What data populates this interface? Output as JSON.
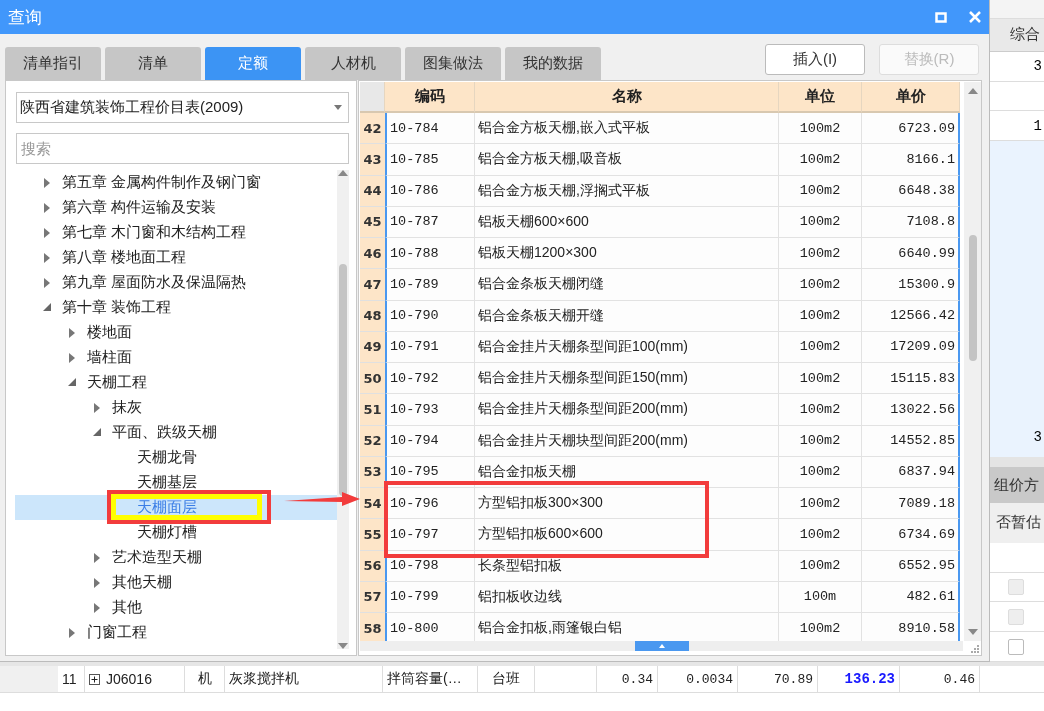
{
  "window": {
    "title": "查询"
  },
  "tabs": [
    {
      "label": "清单指引",
      "selected": false
    },
    {
      "label": "清单",
      "selected": false
    },
    {
      "label": "定额",
      "selected": true
    },
    {
      "label": "人材机",
      "selected": false
    },
    {
      "label": "图集做法",
      "selected": false
    },
    {
      "label": "我的数据",
      "selected": false
    }
  ],
  "buttons": [
    {
      "label": "插入(I)",
      "disabled": false
    },
    {
      "label": "替换(R)",
      "disabled": true
    }
  ],
  "library_select": {
    "value": "陕西省建筑装饰工程价目表(2009)"
  },
  "search": {
    "placeholder": "搜索"
  },
  "tree": [
    {
      "label": "第五章 金属构件制作及钢门窗",
      "expanded": false,
      "selected": false
    },
    {
      "label": "第六章 构件运输及安装",
      "expanded": false,
      "selected": false
    },
    {
      "label": "第七章 木门窗和木结构工程",
      "expanded": false,
      "selected": false
    },
    {
      "label": "第八章 楼地面工程",
      "expanded": false,
      "selected": false
    },
    {
      "label": "第九章 屋面防水及保温隔热",
      "expanded": false,
      "selected": false
    },
    {
      "label": "第十章 装饰工程",
      "expanded": true,
      "selected": false,
      "children": [
        {
          "label": "楼地面",
          "expanded": false,
          "selected": false
        },
        {
          "label": "墙柱面",
          "expanded": false,
          "selected": false
        },
        {
          "label": "天棚工程",
          "expanded": true,
          "selected": false,
          "children": [
            {
              "label": "抹灰",
              "expanded": false,
              "selected": false
            },
            {
              "label": "平面、跌级天棚",
              "expanded": true,
              "selected": false,
              "children": [
                {
                  "label": "天棚龙骨",
                  "selected": false
                },
                {
                  "label": "天棚基层",
                  "selected": false
                },
                {
                  "label": "天棚面层",
                  "selected": true
                },
                {
                  "label": "天棚灯槽",
                  "selected": false
                }
              ]
            },
            {
              "label": "艺术造型天棚",
              "expanded": false,
              "selected": false
            },
            {
              "label": "其他天棚",
              "expanded": false,
              "selected": false
            },
            {
              "label": "其他",
              "expanded": false,
              "selected": false
            }
          ]
        },
        {
          "label": "门窗工程",
          "expanded": false,
          "selected": false
        }
      ]
    }
  ],
  "table": {
    "columns": [
      "编码",
      "名称",
      "单位",
      "单价"
    ],
    "rows": [
      {
        "number": "42",
        "code": "10-784",
        "name": "铝合金方板天棚,嵌入式平板",
        "unit": "100m2",
        "price": "6723.09"
      },
      {
        "number": "43",
        "code": "10-785",
        "name": "铝合金方板天棚,吸音板",
        "unit": "100m2",
        "price": "8166.1"
      },
      {
        "number": "44",
        "code": "10-786",
        "name": "铝合金方板天棚,浮搁式平板",
        "unit": "100m2",
        "price": "6648.38"
      },
      {
        "number": "45",
        "code": "10-787",
        "name": "铝板天棚600×600",
        "unit": "100m2",
        "price": "7108.8"
      },
      {
        "number": "46",
        "code": "10-788",
        "name": "铝板天棚1200×300",
        "unit": "100m2",
        "price": "6640.99"
      },
      {
        "number": "47",
        "code": "10-789",
        "name": "铝合金条板天棚闭缝",
        "unit": "100m2",
        "price": "15300.9"
      },
      {
        "number": "48",
        "code": "10-790",
        "name": "铝合金条板天棚开缝",
        "unit": "100m2",
        "price": "12566.42"
      },
      {
        "number": "49",
        "code": "10-791",
        "name": "铝合金挂片天棚条型间距100(mm)",
        "unit": "100m2",
        "price": "17209.09"
      },
      {
        "number": "50",
        "code": "10-792",
        "name": "铝合金挂片天棚条型间距150(mm)",
        "unit": "100m2",
        "price": "15115.83"
      },
      {
        "number": "51",
        "code": "10-793",
        "name": "铝合金挂片天棚条型间距200(mm)",
        "unit": "100m2",
        "price": "13022.56"
      },
      {
        "number": "52",
        "code": "10-794",
        "name": "铝合金挂片天棚块型间距200(mm)",
        "unit": "100m2",
        "price": "14552.85"
      },
      {
        "number": "53",
        "code": "10-795",
        "name": "铝合金扣板天棚",
        "unit": "100m2",
        "price": "6837.94"
      },
      {
        "number": "54",
        "code": "10-796",
        "name": "方型铝扣板300×300",
        "unit": "100m2",
        "price": "7089.18"
      },
      {
        "number": "55",
        "code": "10-797",
        "name": "方型铝扣板600×600",
        "unit": "100m2",
        "price": "6734.69"
      },
      {
        "number": "56",
        "code": "10-798",
        "name": "长条型铝扣板",
        "unit": "100m2",
        "price": "6552.95"
      },
      {
        "number": "57",
        "code": "10-799",
        "name": "铝扣板收边线",
        "unit": "100m",
        "price": "482.61"
      },
      {
        "number": "58",
        "code": "10-800",
        "name": "铝合金扣板,雨篷银白铝",
        "unit": "100m2",
        "price": "8910.58"
      }
    ]
  },
  "side_panel": {
    "header": "综合",
    "values": [
      "3",
      "1"
    ],
    "highlight_value": "3",
    "section_title": "组价方",
    "column_header": "否暂估",
    "checkboxes": [
      {
        "checked": false,
        "disabled": true
      },
      {
        "checked": false,
        "disabled": true
      },
      {
        "checked": false,
        "disabled": false
      }
    ]
  },
  "bottom_row": {
    "cells": [
      {
        "kind": "index",
        "text": "11"
      },
      {
        "kind": "code",
        "text": "J06016",
        "expanded": false
      },
      {
        "kind": "center",
        "text": "机"
      },
      {
        "kind": "left",
        "text": "灰浆搅拌机"
      },
      {
        "kind": "left",
        "text": "拌筒容量(…"
      },
      {
        "kind": "center",
        "text": "台班"
      },
      {
        "kind": "blank"
      },
      {
        "kind": "number",
        "text": "0.34"
      },
      {
        "kind": "number",
        "text": "0.0034"
      },
      {
        "kind": "number",
        "text": "70.89"
      },
      {
        "kind": "total",
        "text": "136.23"
      },
      {
        "kind": "number",
        "text": "0.46"
      }
    ]
  }
}
